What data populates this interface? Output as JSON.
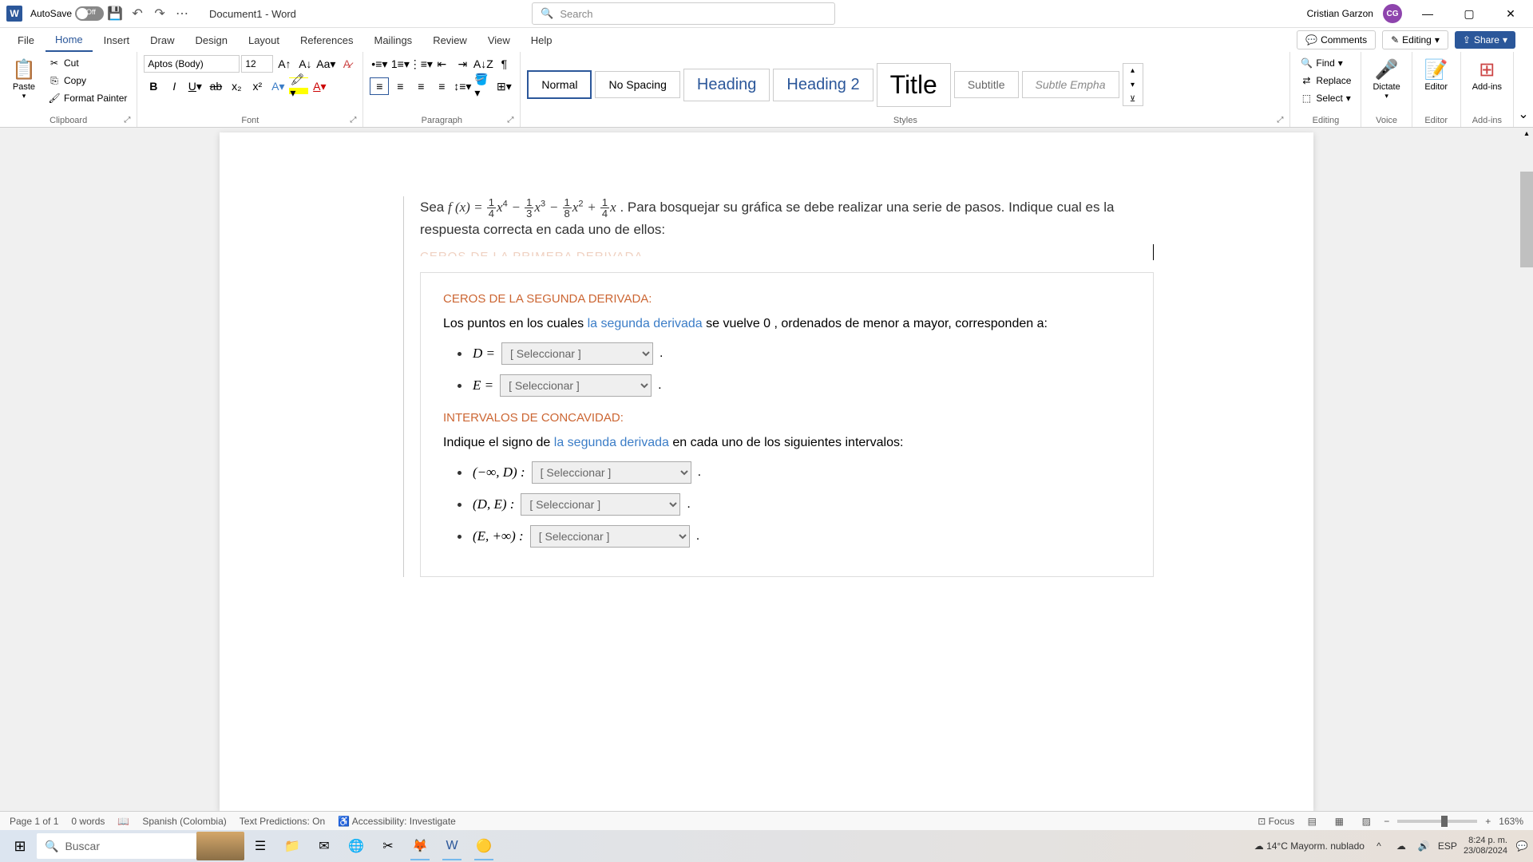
{
  "titlebar": {
    "autosave_label": "AutoSave",
    "doc_title": "Document1  -  Word",
    "search_placeholder": "Search",
    "user_name": "Cristian Garzon",
    "user_initials": "CG"
  },
  "tabs": [
    "File",
    "Home",
    "Insert",
    "Draw",
    "Design",
    "Layout",
    "References",
    "Mailings",
    "Review",
    "View",
    "Help"
  ],
  "active_tab": "Home",
  "ribbon": {
    "clipboard": {
      "label": "Clipboard",
      "paste": "Paste",
      "cut": "Cut",
      "copy": "Copy",
      "format_painter": "Format Painter"
    },
    "font": {
      "label": "Font",
      "name": "Aptos (Body)",
      "size": "12"
    },
    "paragraph": {
      "label": "Paragraph"
    },
    "styles": {
      "label": "Styles",
      "items": [
        "Normal",
        "No Spacing",
        "Heading",
        "Heading 2",
        "Title",
        "Subtitle",
        "Subtle Empha"
      ]
    },
    "editing": {
      "label": "Editing",
      "find": "Find",
      "replace": "Replace",
      "select": "Select"
    },
    "voice": {
      "label": "Voice",
      "dictate": "Dictate"
    },
    "editor": {
      "label": "Editor",
      "editor_btn": "Editor"
    },
    "addins": {
      "label": "Add-ins",
      "addins_btn": "Add-ins"
    }
  },
  "topright": {
    "comments": "Comments",
    "editing": "Editing",
    "share": "Share"
  },
  "document": {
    "problem_prefix": "Sea ",
    "problem_suffix": " . Para bosquejar su gráfica se debe realizar una serie de pasos. Indique cual es la respuesta correcta en cada uno de ellos:",
    "truncated_heading": "CEROS DE LA PRIMERA DERIVADA",
    "section1_title": "CEROS DE LA SEGUNDA DERIVADA:",
    "section1_text_pre": "Los puntos en los cuales ",
    "section1_link": "la segunda derivada",
    "section1_text_post": " se vuelve 0 , ordenados de menor a mayor, corresponden a:",
    "var_d": "D =",
    "var_e": "E =",
    "section2_title": "INTERVALOS DE CONCAVIDAD:",
    "section2_text_pre": "Indique el signo de ",
    "section2_link": "la segunda derivada",
    "section2_text_post": " en cada uno de los siguientes intervalos:",
    "interval1": "(−∞, D) :",
    "interval2": "(D, E) :",
    "interval3": "(E, +∞) :",
    "select_placeholder": "[ Seleccionar ]"
  },
  "statusbar": {
    "page": "Page 1 of 1",
    "words": "0 words",
    "language": "Spanish (Colombia)",
    "predictions": "Text Predictions: On",
    "accessibility": "Accessibility: Investigate",
    "focus": "Focus",
    "zoom": "163%"
  },
  "taskbar": {
    "search_placeholder": "Buscar",
    "weather": "14°C  Mayorm. nublado",
    "ime": "ESP",
    "time": "8:24 p. m.",
    "date": "23/08/2024"
  }
}
